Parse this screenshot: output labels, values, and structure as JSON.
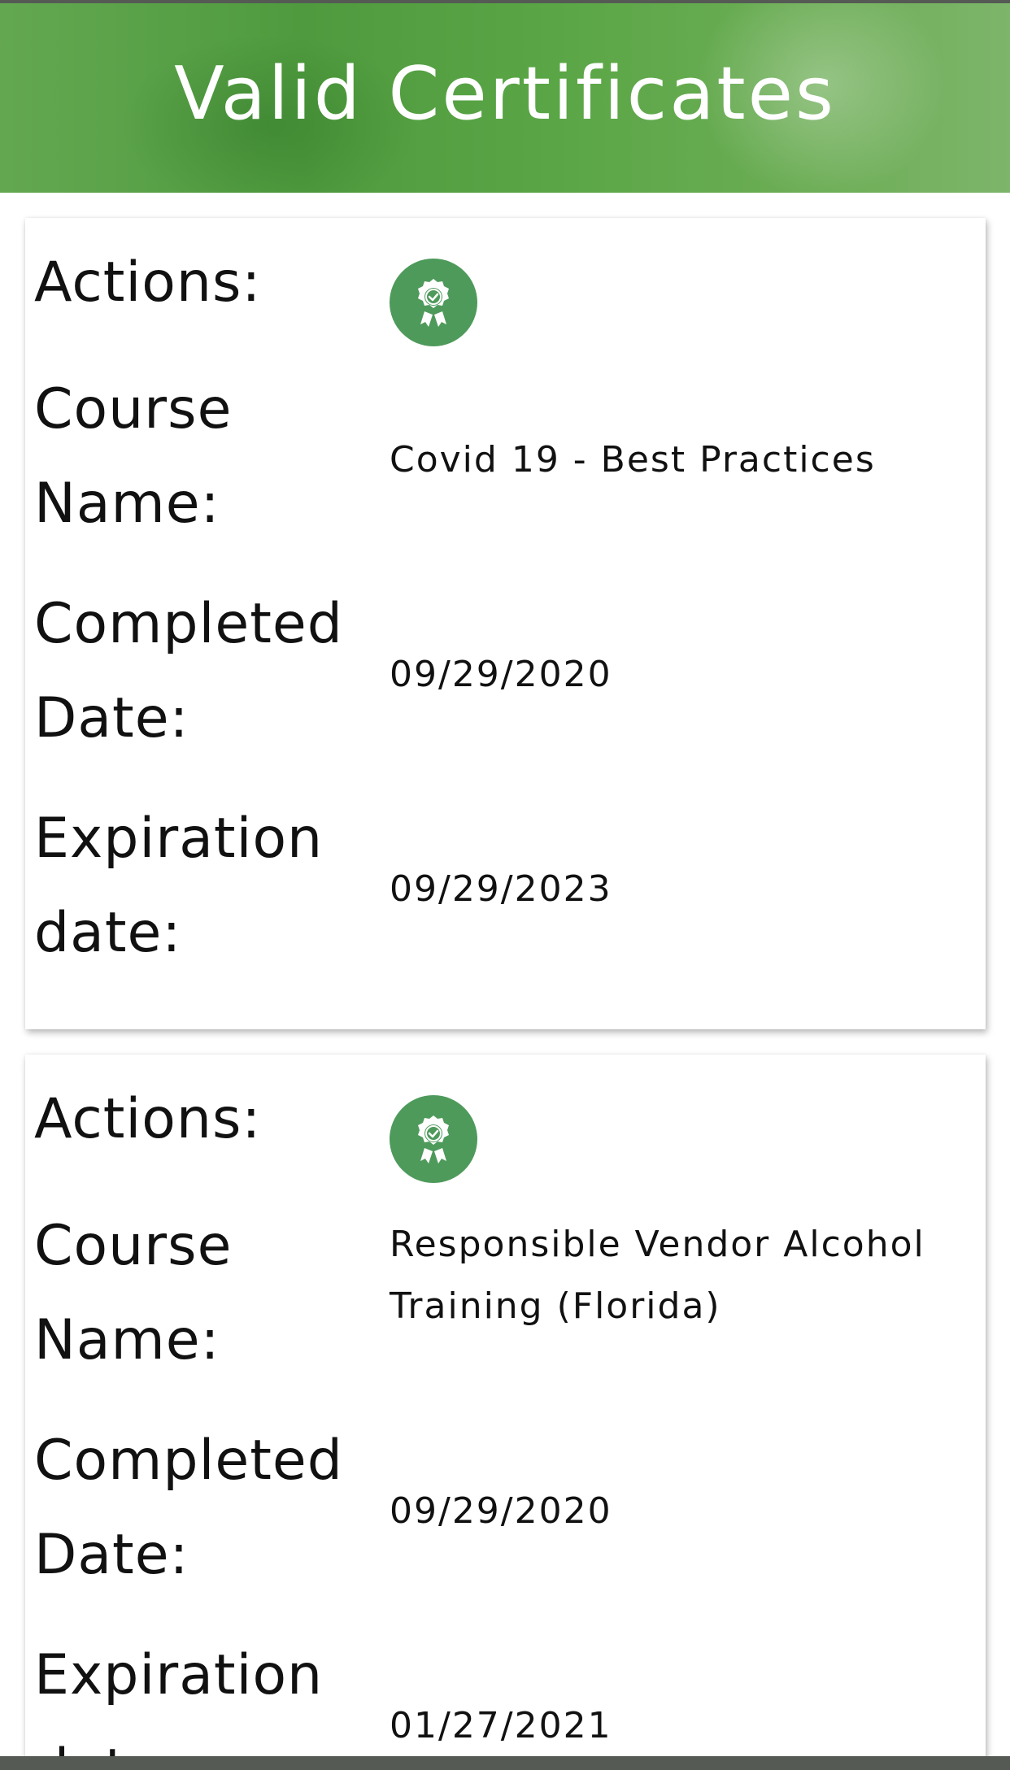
{
  "header": {
    "title": "Valid Certificates"
  },
  "colors": {
    "header_green": "#5aa646",
    "action_button_green": "#4e9a5b",
    "text": "#111111"
  },
  "labels": {
    "actions": "Actions:",
    "course_name_line1": "Course",
    "course_name_line2": "Name:",
    "completed_date_line1": "Completed",
    "completed_date_line2": "Date:",
    "expiration_date_line1": "Expiration",
    "expiration_date_line2": "date:"
  },
  "certificates": [
    {
      "action_icon": "certificate-badge-icon",
      "course_name_line1": "Covid 19 - Best Practices",
      "course_name_line2": "",
      "completed_date": "09/29/2020",
      "expiration_date": "09/29/2023"
    },
    {
      "action_icon": "certificate-badge-icon",
      "course_name_line1": "Responsible Vendor Alcohol",
      "course_name_line2": "Training (Florida)",
      "completed_date": "09/29/2020",
      "expiration_date": "01/27/2021"
    }
  ]
}
